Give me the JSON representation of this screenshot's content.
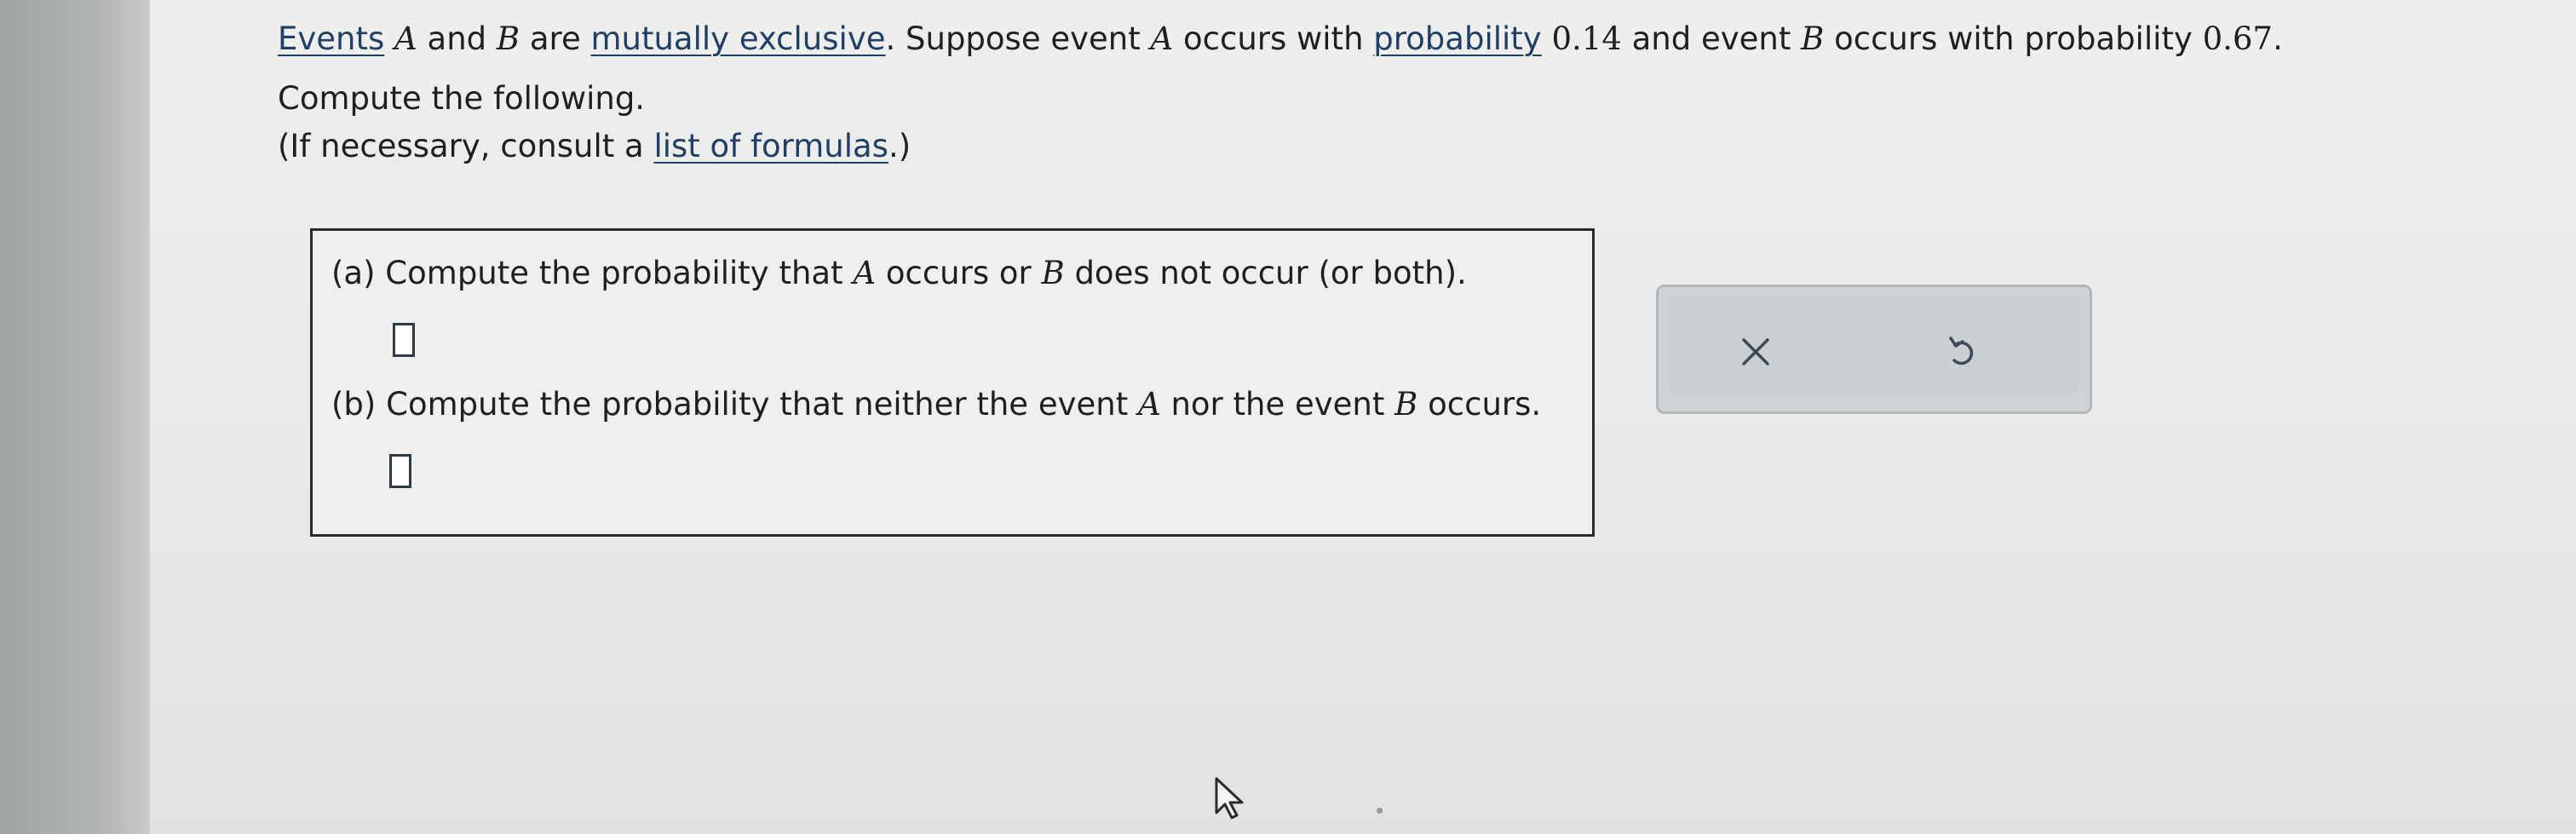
{
  "problem": {
    "events_link": "Events",
    "var_a": "A",
    "and_word": " and ",
    "var_b": "B",
    "are_word": " are ",
    "mutually_exclusive_link": "mutually exclusive",
    "suppose_text": ". Suppose event ",
    "occurs_with": " occurs with ",
    "probability_link": "probability",
    "prob_a": " 0.14",
    "and_event": " and event ",
    "occurs_with_probability": " occurs with probability ",
    "prob_b": "0.67",
    "period": ".",
    "compute_following": "Compute the following.",
    "consult_prefix": "(If necessary, consult a ",
    "list_of_formulas_link": "list of formulas",
    "consult_suffix": ".)"
  },
  "parts": {
    "a": {
      "prefix": "(a) Compute the probability that ",
      "var_a": "A",
      "middle": " occurs or ",
      "var_b": "B",
      "suffix": " does not occur (or both).",
      "answer_value": ""
    },
    "b": {
      "prefix": "(b) Compute the probability that neither the event ",
      "var_a": "A",
      "middle": " nor the event ",
      "var_b": "B",
      "suffix": " occurs.",
      "answer_value": ""
    }
  },
  "actions": {
    "clear_icon": "close-icon",
    "undo_icon": "undo-icon",
    "icon_color": "#3d4a5a"
  },
  "colors": {
    "link": "#1f3f66",
    "text": "#1e1f21",
    "panel": "#cbcfd2"
  }
}
